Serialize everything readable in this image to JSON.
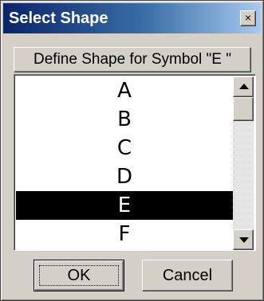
{
  "window": {
    "title": "Select Shape",
    "close_glyph": "×"
  },
  "header": {
    "text": "Define Shape for Symbol \"E  \""
  },
  "list": {
    "items": [
      "A",
      "B",
      "C",
      "D",
      "E",
      "F"
    ],
    "selected_index": 4
  },
  "buttons": {
    "ok_label": "OK",
    "cancel_label": "Cancel"
  },
  "icons": {
    "close": "close-icon",
    "scroll_up": "scroll-up-arrow-icon",
    "scroll_down": "scroll-down-arrow-icon"
  },
  "colors": {
    "title_gradient_start": "#0a246a",
    "title_gradient_end": "#a6caf0",
    "face": "#d4d0c8",
    "selection": "#000000"
  }
}
